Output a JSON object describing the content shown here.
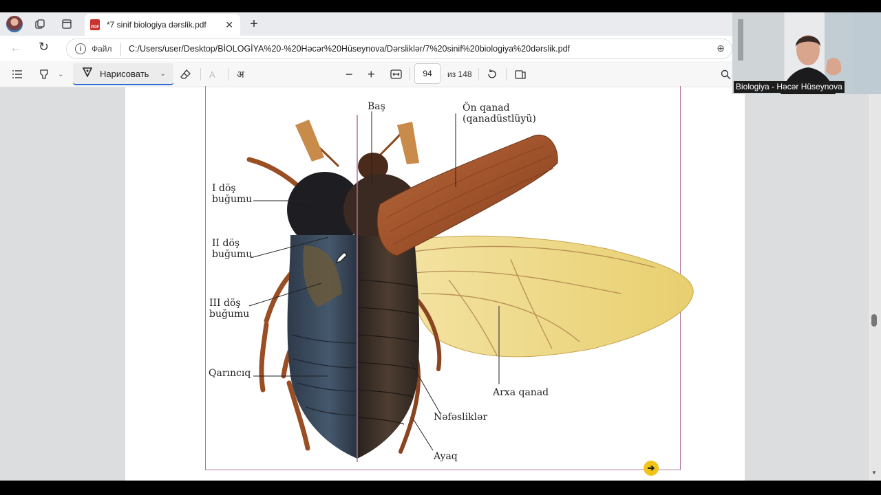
{
  "browser": {
    "tab_title": "*7 sinif biologiya dərslik.pdf",
    "new_tab_icon": "+",
    "file_label": "Файл",
    "url": "C:/Users/user/Desktop/BİOLOGİYA%20-%20Həcər%20Hüseynova/Dərsliklər/7%20sinif%20biologiya%20dərslik.pdf"
  },
  "pdf_toolbar": {
    "draw_label": "Нарисовать",
    "page_number": "94",
    "page_total": "из 148",
    "read_aloud_icon": "अ"
  },
  "diagram": {
    "labels": {
      "head": "Baş",
      "forewing_line1": "Ön qanad",
      "forewing_line2": "(qanadüstlüyü)",
      "seg1_line1": "I döş",
      "seg1_line2": "buğumu",
      "seg2_line1": "II döş",
      "seg2_line2": "buğumu",
      "seg3_line1": "III döş",
      "seg3_line2": "buğumu",
      "abdomen": "Qarıncıq",
      "hindwing": "Arxa qanad",
      "spiracles": "Nəfəsliklər",
      "leg": "Ayaq"
    }
  },
  "webcam": {
    "caption": "Biologiya - Həcər Hüseynova"
  },
  "colors": {
    "accent": "#2d6bd3",
    "frame": "#b0709f",
    "next_button": "#f2c318"
  }
}
